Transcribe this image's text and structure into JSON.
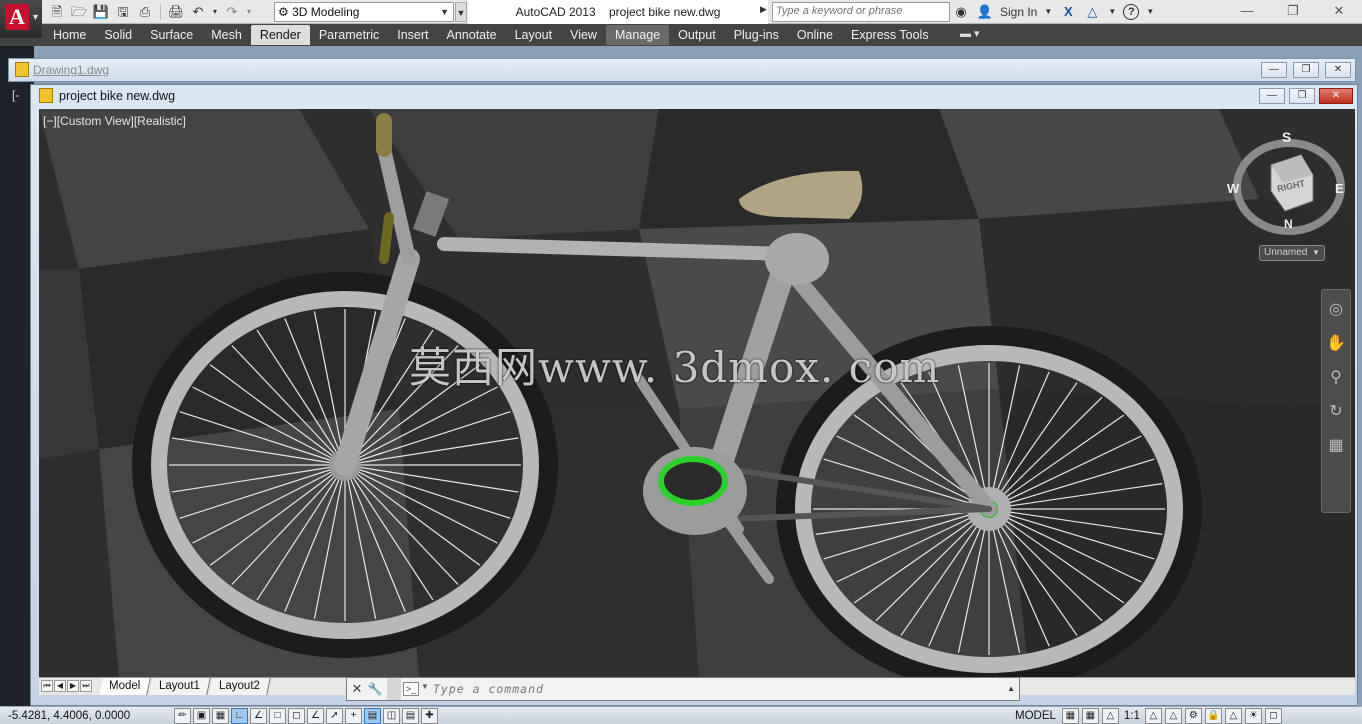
{
  "app": {
    "logo_letter": "A",
    "workspace": "3D Modeling",
    "title": "AutoCAD 2013    project bike new.dwg",
    "search_placeholder": "Type a keyword or phrase",
    "sign_in": "Sign In"
  },
  "ribbon": {
    "tabs": [
      "Home",
      "Solid",
      "Surface",
      "Mesh",
      "Render",
      "Parametric",
      "Insert",
      "Annotate",
      "Layout",
      "View",
      "Manage",
      "Output",
      "Plug-ins",
      "Online",
      "Express Tools"
    ],
    "active_tab": "Render",
    "highlighted_tab": "Manage"
  },
  "background_doc": {
    "title": "Drawing1.dwg",
    "left_marker": "[-"
  },
  "drawing": {
    "title": "project bike new.dwg",
    "viewport_label_parts": [
      "[−]",
      "[Custom View]",
      "[Realistic]"
    ],
    "watermark": "莫西网www. 3dmox. com"
  },
  "viewcube": {
    "north": "N",
    "south": "S",
    "east": "E",
    "west": "W",
    "face": "RIGHT",
    "ucs_menu": "Unnamed"
  },
  "layout_tabs": [
    "Model",
    "Layout1",
    "Layout2"
  ],
  "active_layout": "Model",
  "command_line": {
    "placeholder": "Type a command"
  },
  "statusbar": {
    "coordinates": "-5.4281, 4.4006, 0.0000",
    "space": "MODEL",
    "annotation_scale": "1:1"
  },
  "colors": {
    "ribbon_bg": "#444444",
    "autocad_red": "#c8102e",
    "viewport_bg": "#262626",
    "hub_green": "#18c018"
  }
}
